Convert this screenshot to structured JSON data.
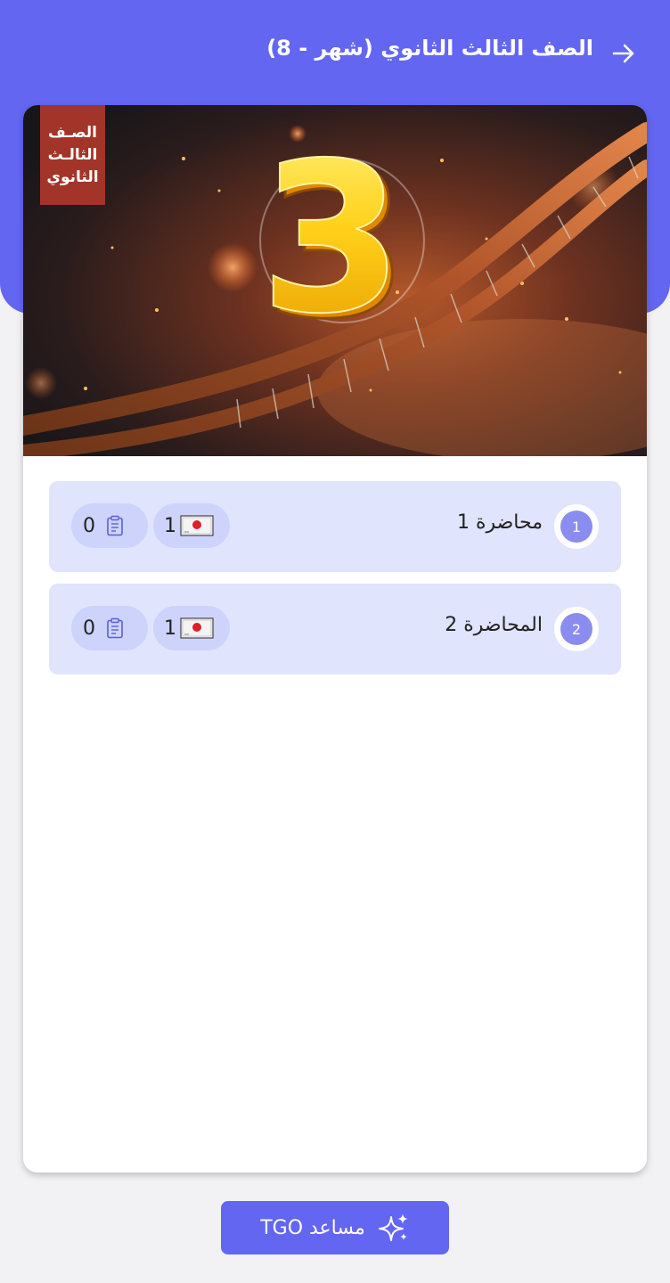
{
  "header": {
    "title": "الصف الثالث الثانوي (شهر - 8)",
    "back_icon": "arrow-right-icon"
  },
  "banner": {
    "badge_lines": [
      "الصـف",
      "الثالـث",
      "الثانوي"
    ],
    "big_number": "3"
  },
  "lectures": [
    {
      "number": "1",
      "title": "محاضرة 1",
      "video_count": "1",
      "doc_count": "0"
    },
    {
      "number": "2",
      "title": "المحاضرة 2",
      "video_count": "1",
      "doc_count": "0"
    }
  ],
  "assistant": {
    "label": "مساعد TGO",
    "icon": "sparkles-icon"
  },
  "colors": {
    "primary": "#6366f1",
    "lecture_bg": "#e0e4fd",
    "pill_bg": "#cdd3fb",
    "number_circle": "#8a8cf0",
    "badge_red": "#a3342a"
  }
}
